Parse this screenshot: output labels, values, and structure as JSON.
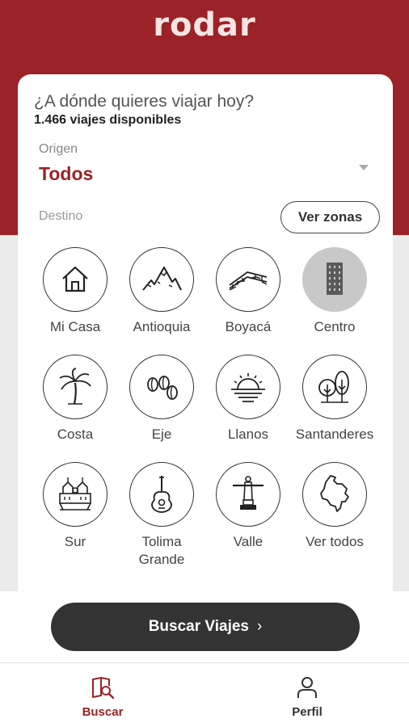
{
  "app": {
    "logo": "rodar"
  },
  "search_card": {
    "question": "¿A dónde quieres viajar hoy?",
    "trip_count": "1.466 viajes disponibles",
    "origin_label": "Origen",
    "origin_value": "Todos",
    "destination_label": "Destino",
    "zones_button": "Ver zonas"
  },
  "zones": [
    {
      "label": "Mi Casa",
      "icon": "house-icon",
      "selected": false
    },
    {
      "label": "Antioquia",
      "icon": "mountains-icon",
      "selected": false
    },
    {
      "label": "Boyacá",
      "icon": "bridge-icon",
      "selected": false
    },
    {
      "label": "Centro",
      "icon": "building-icon",
      "selected": true
    },
    {
      "label": "Costa",
      "icon": "palm-tree-icon",
      "selected": false
    },
    {
      "label": "Eje",
      "icon": "coffee-beans-icon",
      "selected": false
    },
    {
      "label": "Llanos",
      "icon": "sunset-icon",
      "selected": false
    },
    {
      "label": "Santanderes",
      "icon": "trees-icon",
      "selected": false
    },
    {
      "label": "Sur",
      "icon": "church-icon",
      "selected": false
    },
    {
      "label": "Tolima Grande",
      "icon": "guitar-icon",
      "selected": false
    },
    {
      "label": "Valle",
      "icon": "cristo-rey-icon",
      "selected": false
    },
    {
      "label": "Ver todos",
      "icon": "colombia-map-icon",
      "selected": false
    }
  ],
  "search_button": {
    "label": "Buscar Viajes",
    "chevron": "›"
  },
  "tabbar": {
    "buscar": {
      "label": "Buscar",
      "icon": "book-search-icon"
    },
    "perfil": {
      "label": "Perfil",
      "icon": "person-icon"
    }
  },
  "colors": {
    "brand": "#9b2226",
    "dark": "#333333",
    "selected_zone": "#c8c8c8"
  }
}
